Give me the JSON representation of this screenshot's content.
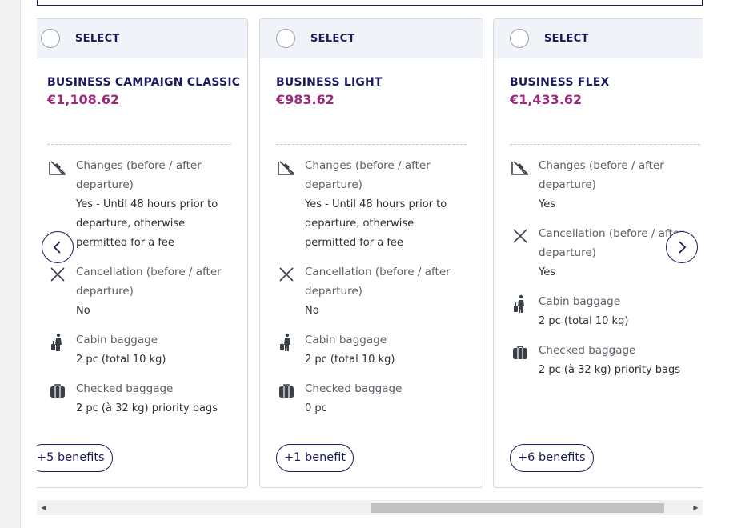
{
  "select_label": "SELECT",
  "feature_labels": {
    "changes": "Changes (before / after departure)",
    "cancellation": "Cancellation (before / after departure)",
    "cabin": "Cabin baggage",
    "checked": "Checked baggage"
  },
  "fares": [
    {
      "name": "BUSINESS CAMPAIGN CLASSIC",
      "price": "€1,108.62",
      "changes": "Yes - Until 48 hours prior to departure, otherwise permitted for a fee",
      "cancellation": "No",
      "cabin": "2 pc (total 10 kg)",
      "checked": "2 pc (à 32 kg) priority bags",
      "benefits": "+5 benefits"
    },
    {
      "name": "BUSINESS LIGHT",
      "price": "€983.62",
      "changes": "Yes - Until 48 hours prior to departure, otherwise permitted for a fee",
      "cancellation": "No",
      "cabin": "2 pc (total 10 kg)",
      "checked": "0 pc",
      "benefits": "+1 benefit"
    },
    {
      "name": "BUSINESS FLEX",
      "price": "€1,433.62",
      "changes": "Yes",
      "cancellation": "Yes",
      "cabin": "2 pc (total 10 kg)",
      "checked": "2 pc (à 32 kg) priority bags",
      "benefits": "+6 benefits"
    }
  ],
  "colors": {
    "brand_navy": "#1b1a5c",
    "price_magenta": "#9c2a7a",
    "header_bg": "#f0f3f7"
  },
  "icons": [
    "changes-icon",
    "cancel-x-icon",
    "cabin-baggage-icon",
    "checked-baggage-icon",
    "chevron-left-icon",
    "chevron-right-icon"
  ]
}
